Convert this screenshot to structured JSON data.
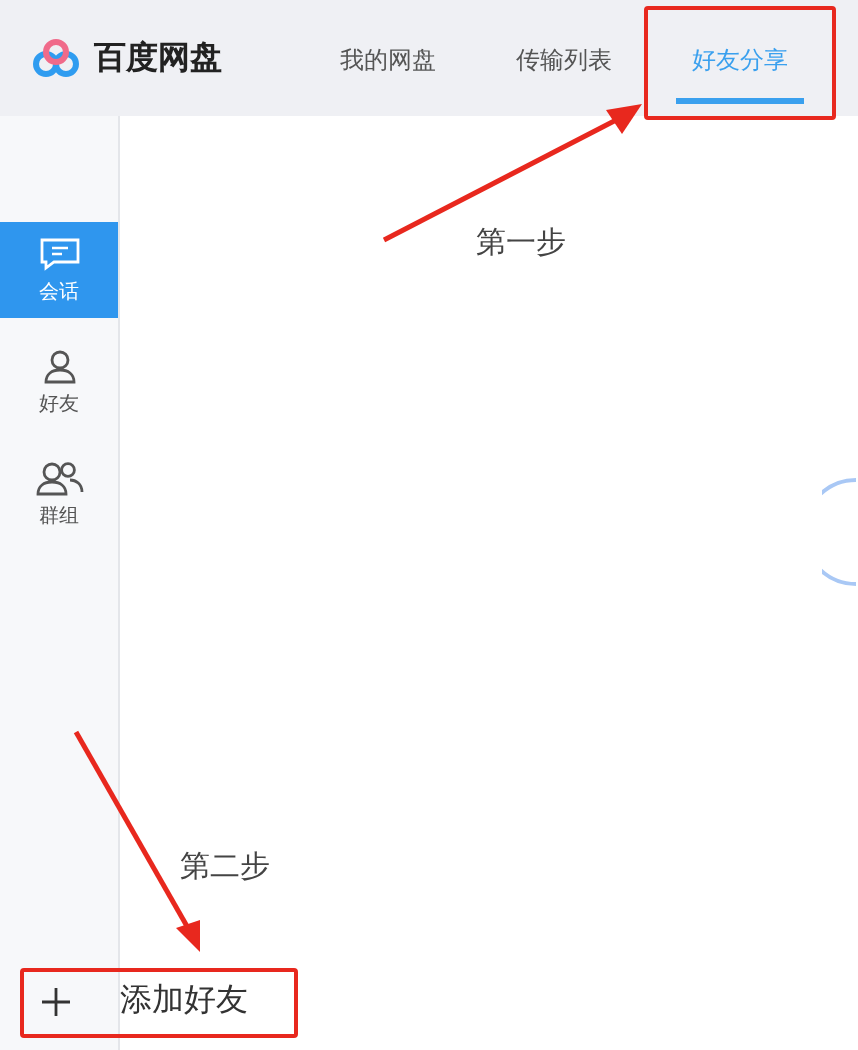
{
  "header": {
    "logo_text": "百度网盘",
    "tabs": [
      {
        "label": "我的网盘",
        "selected": false
      },
      {
        "label": "传输列表",
        "selected": false
      },
      {
        "label": "好友分享",
        "selected": true
      }
    ]
  },
  "sidebar": {
    "items": [
      {
        "label": "会话",
        "kind": "chat",
        "selected": true
      },
      {
        "label": "好友",
        "kind": "friend",
        "selected": false
      },
      {
        "label": "群组",
        "kind": "group",
        "selected": false
      }
    ]
  },
  "add_friend_button": {
    "label": "添加好友"
  },
  "annotations": [
    {
      "label": "第一步"
    },
    {
      "label": "第二步"
    }
  ]
}
